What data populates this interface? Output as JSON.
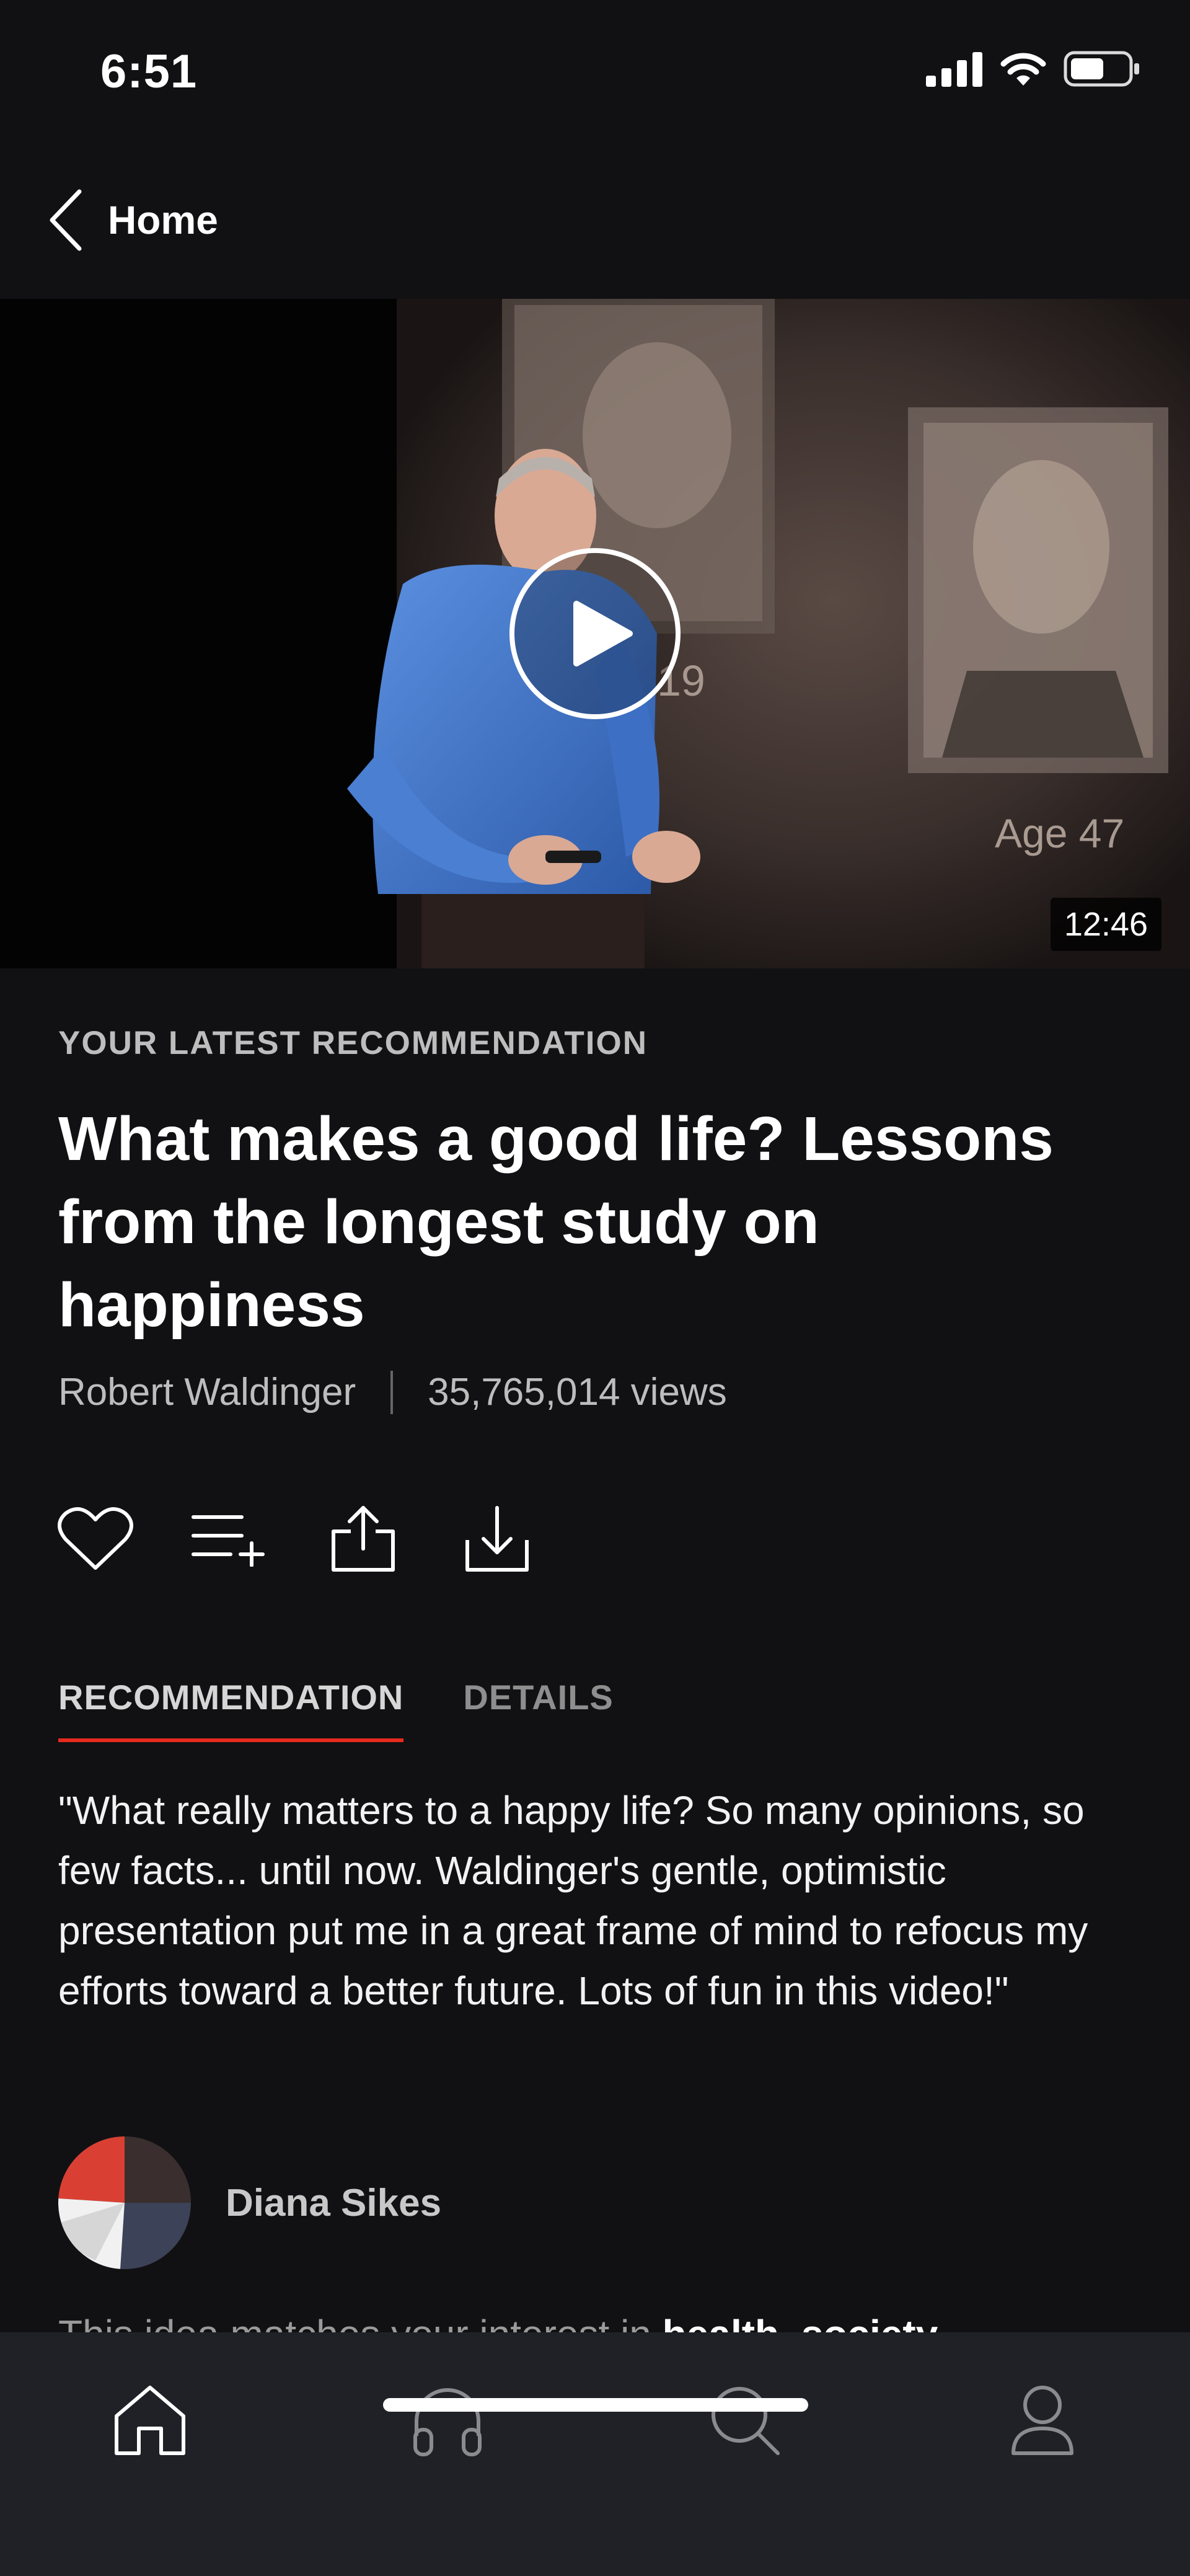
{
  "status_bar": {
    "time": "6:51"
  },
  "nav": {
    "back_label": "Home"
  },
  "video": {
    "duration": "12:46",
    "slide_text_1": "19",
    "slide_text_2": "Age 47"
  },
  "talk": {
    "eyebrow": "YOUR LATEST RECOMMENDATION",
    "title": "What makes a good life? Lessons from the longest study on happiness",
    "speaker": "Robert Waldinger",
    "views": "35,765,014 views"
  },
  "actions": [
    {
      "icon": "heart-icon"
    },
    {
      "icon": "add-to-list-icon"
    },
    {
      "icon": "share-icon"
    },
    {
      "icon": "download-icon"
    }
  ],
  "tabs": {
    "recommendation": "RECOMMENDATION",
    "details": "DETAILS"
  },
  "recommendation": {
    "quote": "\"What really matters to a happy life? So many opinions, so few facts... until now. Waldinger's gentle, optimistic presentation put me in a great frame of mind to refocus my efforts toward a better future.  Lots of fun in this video!\"",
    "reviewer": "Diana Sikes",
    "interest_prefix": "This idea matches your interest in ",
    "interest_topics": "health, society"
  },
  "tabbar": [
    {
      "icon": "home-icon",
      "active": true
    },
    {
      "icon": "headphones-icon",
      "active": false
    },
    {
      "icon": "search-icon",
      "active": false
    },
    {
      "icon": "profile-icon",
      "active": false
    }
  ],
  "colors": {
    "accent": "#e62b1e",
    "background": "#111113",
    "tabbar": "#202126"
  }
}
